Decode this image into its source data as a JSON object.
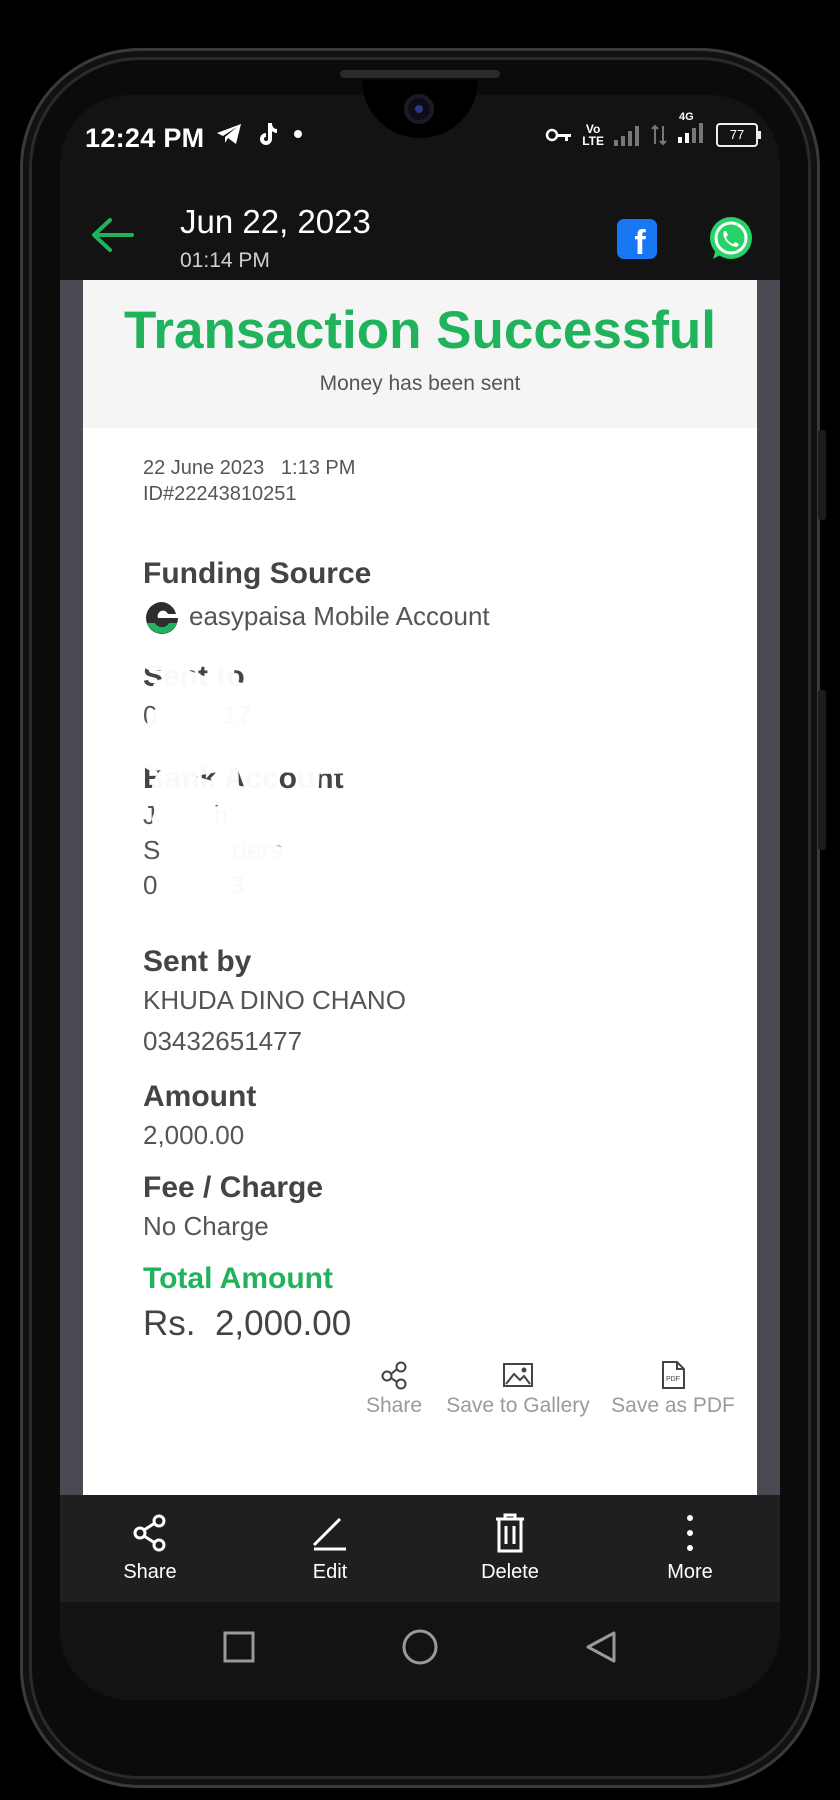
{
  "status_bar": {
    "time": "12:24 PM",
    "network_label": "4G",
    "volte_line1": "Vo",
    "volte_line2": "LTE",
    "battery": "77"
  },
  "header": {
    "date": "Jun 22, 2023",
    "time": "01:14 PM",
    "facebook_icon": "facebook-icon",
    "whatsapp_icon": "whatsapp-icon"
  },
  "receipt": {
    "title": "Transaction Successful",
    "subtitle": "Money has been sent",
    "date_time": "22 June 2023   1:13 PM",
    "transaction_id": "ID#22243810251",
    "funding_source": {
      "label": "Funding Source",
      "value": "easypaisa Mobile Account"
    },
    "sent_to": {
      "label": "Sent to",
      "value": "0         17"
    },
    "bank_account": {
      "label": "Bank Account",
      "line1": "J        h",
      "line2": "S          ders",
      "line3": "0          3"
    },
    "sent_by": {
      "label": "Sent by",
      "name": "KHUDA DINO CHANO",
      "number": "03432651477"
    },
    "amount": {
      "label": "Amount",
      "value": "2,000.00"
    },
    "fee": {
      "label": "Fee / Charge",
      "value": "No Charge"
    },
    "total": {
      "label": "Total Amount",
      "value": "Rs.  2,000.00"
    },
    "actions": {
      "share": "Share",
      "gallery": "Save to Gallery",
      "pdf": "Save as PDF"
    }
  },
  "toolbar": {
    "share": "Share",
    "edit": "Edit",
    "delete": "Delete",
    "more": "More"
  },
  "colors": {
    "accent_green": "#21b35b",
    "facebook_blue": "#1877f2",
    "whatsapp_green": "#25d366"
  }
}
